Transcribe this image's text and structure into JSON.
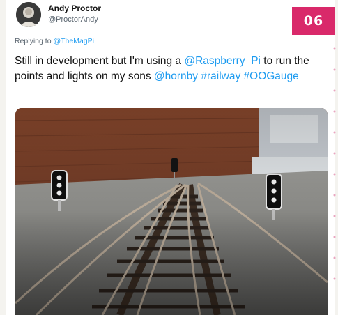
{
  "author": {
    "name": "Andy Proctor",
    "handle": "@ProctorAndy"
  },
  "badge": "06",
  "reply": {
    "prefix": "Replying to ",
    "mention": "@TheMagPi"
  },
  "tweet": {
    "text_1": "Still in development but I'm using a ",
    "link_1": "@Raspberry_Pi",
    "text_2": " to run the points and lights on my sons ",
    "link_2": "@hornby",
    "text_3": " ",
    "link_3": "#railway",
    "text_4": " ",
    "link_4": "#OOGauge"
  },
  "colors": {
    "link": "#1d9bf0",
    "badge": "#d9296a"
  },
  "icons": [
    "avatar-photo"
  ]
}
